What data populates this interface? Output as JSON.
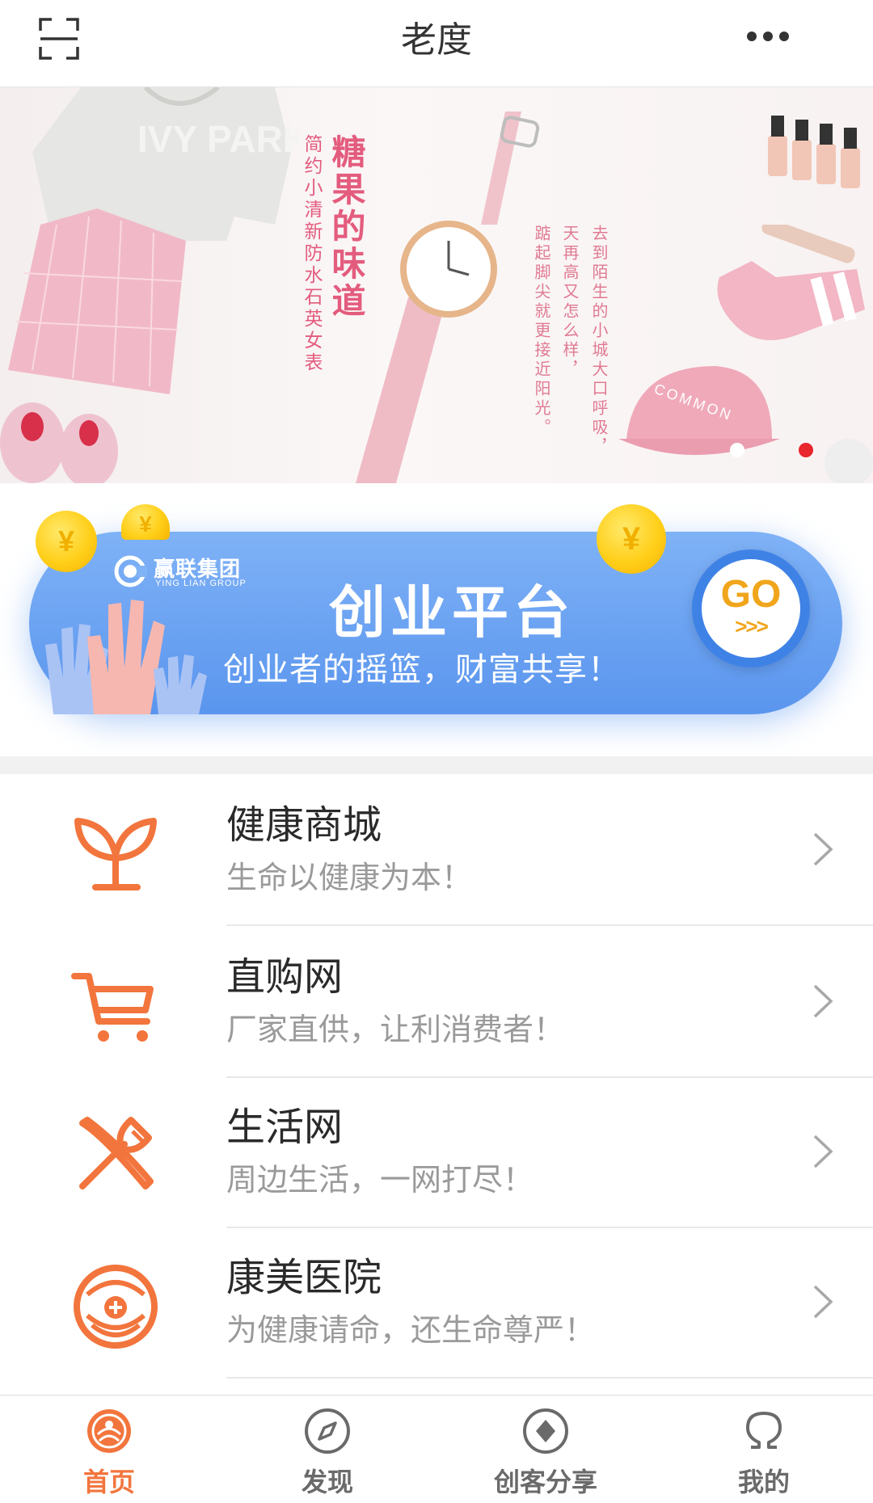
{
  "header": {
    "title": "老度"
  },
  "banner": {
    "title_main": "糖果的味道",
    "title_sub": "简约小清新防水石英女表",
    "poem_line1": "去到陌生的小城大口呼吸，",
    "poem_line2": "天再高又怎么样，",
    "poem_line3": "踮起脚尖就更接近阳光。",
    "hoodie_text": "IVY PARK",
    "cap_text": "COMMON",
    "slide_count": 2,
    "active_slide": 2
  },
  "startup": {
    "logo_name": "赢联集团",
    "logo_en": "YING LIAN GROUP",
    "title": "创业平台",
    "slogan": "创业者的摇篮，财富共享！",
    "go_label": "GO",
    "go_arrows": ">>>",
    "coin_symbol": "¥"
  },
  "list": [
    {
      "name": "健康商城",
      "desc": "生命以健康为本！",
      "icon": "sprout-icon"
    },
    {
      "name": "直购网",
      "desc": "厂家直供，让利消费者！",
      "icon": "cart-icon"
    },
    {
      "name": "生活网",
      "desc": "周边生活，一网打尽！",
      "icon": "fork-knife-icon"
    },
    {
      "name": "康美医院",
      "desc": "为健康请命，还生命尊严！",
      "icon": "hospital-icon"
    }
  ],
  "tabs": [
    {
      "label": "首页",
      "active": true,
      "icon": "home-icon"
    },
    {
      "label": "发现",
      "active": false,
      "icon": "compass-icon"
    },
    {
      "label": "创客分享",
      "active": false,
      "icon": "share-diamond-icon"
    },
    {
      "label": "我的",
      "active": false,
      "icon": "profile-icon"
    }
  ],
  "colors": {
    "accent": "#f2753d",
    "banner_text": "#e35c7e",
    "pill_blue": "#5a95ee",
    "go_yellow": "#f0a51b",
    "active_dot": "#e8262c"
  }
}
